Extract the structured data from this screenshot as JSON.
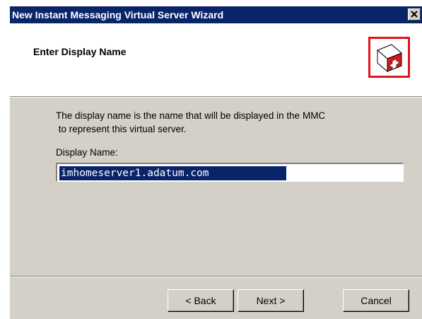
{
  "window": {
    "title": "New Instant Messaging Virtual Server Wizard"
  },
  "header": {
    "title": "Enter Display Name",
    "logo_icon": "first-aid-kit-icon",
    "logo_border_color": "#e2141a"
  },
  "main": {
    "description": "The display name is the name that will be displayed in the MMC\n to represent this virtual server.",
    "display_name_label": "Display Name:",
    "display_name_value": "imhomeserver1.adatum.com"
  },
  "footer": {
    "back_label": "< Back",
    "next_label": "Next >",
    "cancel_label": "Cancel"
  },
  "colors": {
    "titlebar": "#0a246a",
    "dialog_bg": "#d4d0c8",
    "selection": "#0a246a"
  }
}
